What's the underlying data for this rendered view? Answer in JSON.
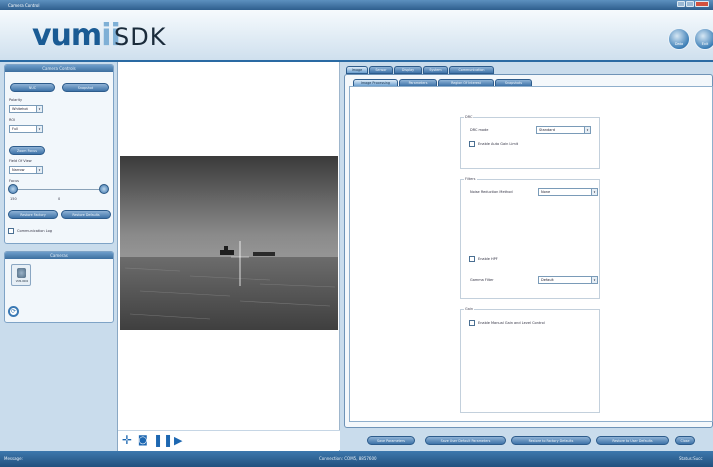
{
  "window": {
    "title": "Camera Control"
  },
  "header": {
    "logo_main": "vum",
    "logo_accent": "ii",
    "sdk_label": "SDK",
    "icon_1": "Data",
    "icon_2": "Exit"
  },
  "camera_controls": {
    "title": "Camera Controls",
    "btn_nuc": "NUC",
    "btn_snapshot": "Snapshot",
    "polarity_label": "Polarity",
    "polarity_value": "Whitehot",
    "roi_label": "ROI",
    "roi_value": "Full",
    "btn_zoom": "Zoom Focus",
    "fov_label": "Field Of View",
    "fov_value": "Narrow",
    "focus_label": "Focus",
    "focus_min": "150",
    "focus_val": "0",
    "btn_factory": "Restore Factory",
    "btn_defaults": "Restore Defaults",
    "comm_log": "Communication Log"
  },
  "cameras": {
    "title": "Cameras",
    "camera_label": "VUM-0002"
  },
  "tabs_top": [
    "Image",
    "Sensor",
    "Display",
    "System",
    "Communication"
  ],
  "tabs_sub": [
    "Image Processing",
    "Parameters",
    "Region Of Interest",
    "Snapshots"
  ],
  "drc": {
    "group": "DRC",
    "mode_label": "DRC mode",
    "mode_value": "Standard",
    "auto_gain": "Enable Auto Gain Limit"
  },
  "filters": {
    "group": "Filters",
    "noise_label": "Noise Reduction Method",
    "noise_value": "None",
    "hpf": "Enable HPF",
    "gamma_label": "Gamma Filter",
    "gamma_value": "Default"
  },
  "gain": {
    "group": "Gain",
    "manual": "Enable Manual Gain and Level Control"
  },
  "bottom_buttons": [
    "Save Parameters",
    "Save User Default Parameters",
    "Restore to Factory Defaults",
    "Restore to User Defaults",
    "Close"
  ],
  "status": {
    "message": "Message:",
    "connection": "Connection:  COM5, 8857600",
    "status": "Status:Succ"
  },
  "colors": {
    "accent": "#2a6aa3",
    "panel": "#c9dcec"
  }
}
